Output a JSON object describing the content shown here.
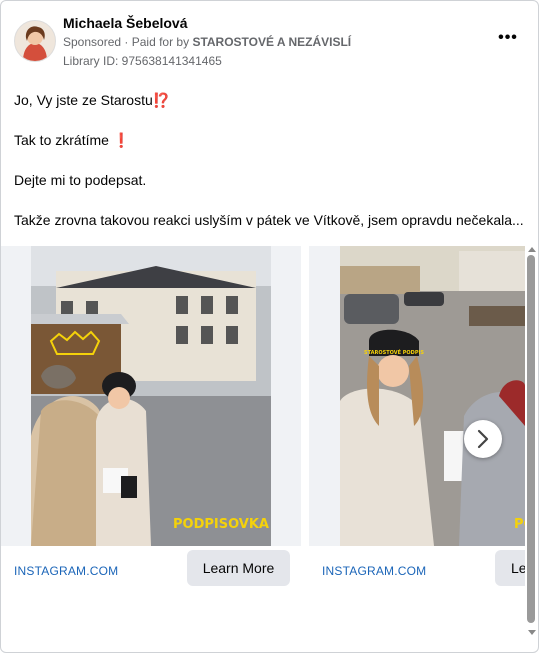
{
  "author": {
    "name": "Michaela Šebelová",
    "sponsored": "Sponsored",
    "paid_for_prefix": "· Paid for by",
    "payer": "STAROSTOVÉ A NEZÁVISLÍ",
    "library_id": "Library ID: 975638141341465"
  },
  "post": {
    "line1": "Jo, Vy jste ze Starostu",
    "line1_emoji": "⁉️",
    "line2": "Tak to zkrátíme",
    "line2_emoji": "❗",
    "line3": "Dejte mi to podepsat.",
    "line4": "Takže zrovna takovou reakci uslyším v pátek ve Vítkově, jsem opravdu nečekala..."
  },
  "carousel": {
    "slides": [
      {
        "domain": "INSTAGRAM.COM",
        "cta": "Learn More",
        "sticker": "PODPISOVKA"
      },
      {
        "domain": "INSTAGRAM.COM",
        "cta": "Learn More",
        "sticker": "PODPISOVKA",
        "hat_text": "STAROSTOVÉ PODPIS"
      }
    ],
    "next_icon": "chevron-right-icon"
  },
  "colors": {
    "link": "#1b65b8",
    "meta": "#65676b",
    "button_bg": "#e4e6eb",
    "sticker": "#f5d20a"
  }
}
